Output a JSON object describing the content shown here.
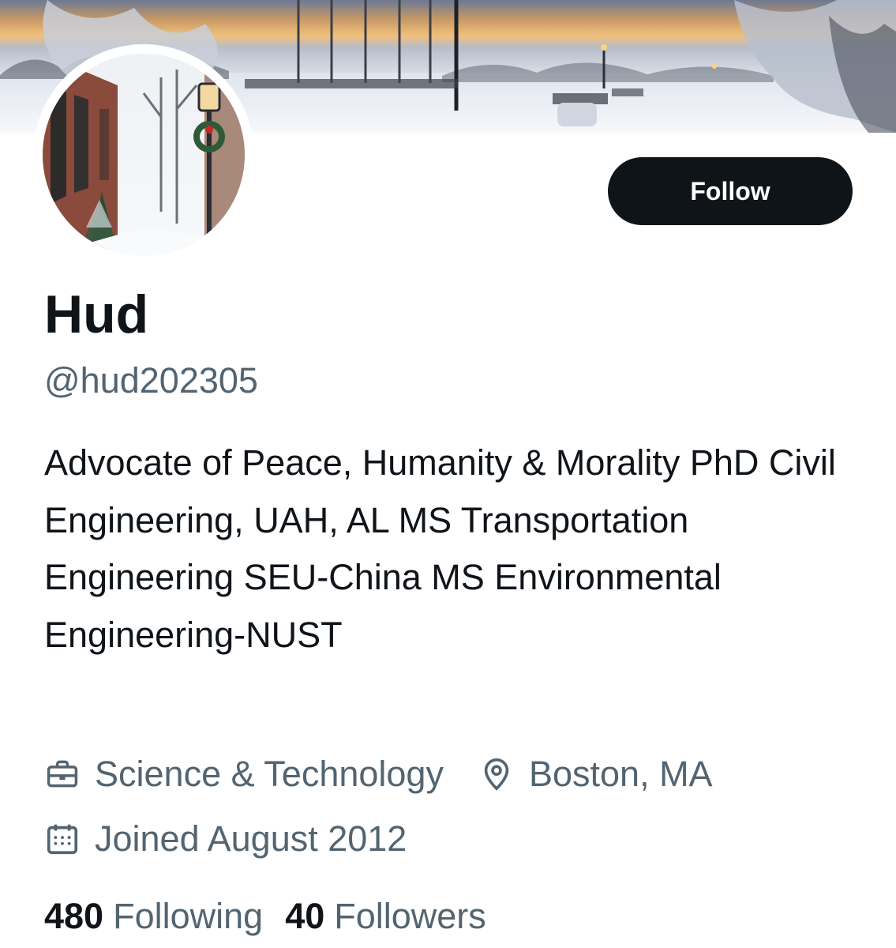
{
  "profile": {
    "display_name": "Hud",
    "handle": "@hud202305",
    "bio": "Advocate of Peace, Humanity & Morality PhD Civil Engineering, UAH, AL MS Transportation Engineering SEU-China MS Environmental Engineering-NUST",
    "category": "Science & Technology",
    "location": "Boston, MA",
    "joined": "Joined August 2012"
  },
  "actions": {
    "follow_label": "Follow"
  },
  "stats": {
    "following_count": "480",
    "following_label": "Following",
    "followers_count": "40",
    "followers_label": "Followers"
  },
  "icons": {
    "category": "briefcase-icon",
    "location": "location-pin-icon",
    "joined": "calendar-icon"
  },
  "colors": {
    "text_primary": "#0f1419",
    "text_secondary": "#536471",
    "button_bg": "#0f1419",
    "button_text": "#ffffff"
  }
}
